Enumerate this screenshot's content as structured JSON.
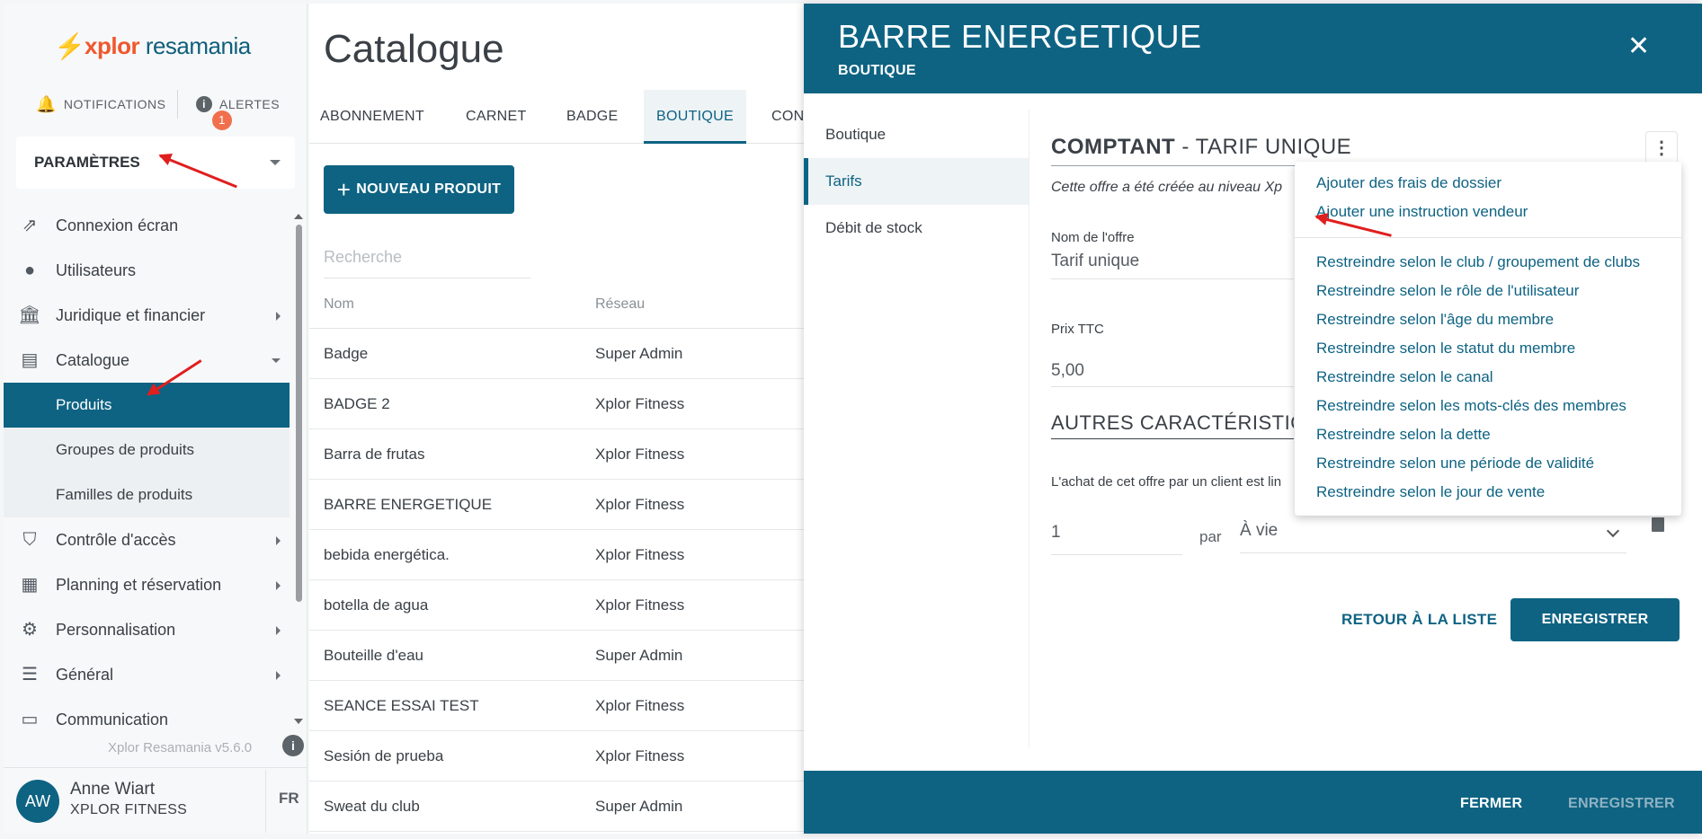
{
  "sidebar": {
    "logo": {
      "brand": "xplor",
      "product": "resamania"
    },
    "notifications_label": "NOTIFICATIONS",
    "alerts_label": "ALERTES",
    "alerts_count": "1",
    "settings_label": "PARAMÈTRES",
    "items": [
      {
        "label": "Connexion écran",
        "icon": "screen-share-icon"
      },
      {
        "label": "Utilisateurs",
        "icon": "user-circle-icon"
      },
      {
        "label": "Juridique et financier",
        "icon": "bank-icon"
      },
      {
        "label": "Catalogue",
        "icon": "library-icon"
      }
    ],
    "catalogue_sub": [
      {
        "label": "Produits"
      },
      {
        "label": "Groupes de produits"
      },
      {
        "label": "Familles de produits"
      }
    ],
    "items2": [
      {
        "label": "Contrôle d'accès",
        "icon": "shield-check-icon"
      },
      {
        "label": "Planning et réservation",
        "icon": "calendar-icon"
      },
      {
        "label": "Personnalisation",
        "icon": "gear-icon"
      },
      {
        "label": "Général",
        "icon": "list-icon"
      },
      {
        "label": "Communication",
        "icon": "contact-card-icon"
      }
    ],
    "version": "Xplor Resamania v5.6.0",
    "user": {
      "initials": "AW",
      "name": "Anne Wiart",
      "org": "XPLOR FITNESS",
      "lang": "FR"
    }
  },
  "catalogue": {
    "title": "Catalogue",
    "tabs": [
      "ABONNEMENT",
      "CARNET",
      "BADGE",
      "BOUTIQUE",
      "CON"
    ],
    "new_button": "NOUVEAU PRODUIT",
    "search_placeholder": "Recherche",
    "columns": [
      "Nom",
      "Réseau"
    ],
    "rows": [
      [
        "Badge",
        "Super Admin"
      ],
      [
        "BADGE 2",
        "Xplor Fitness"
      ],
      [
        "Barra de frutas",
        "Xplor Fitness"
      ],
      [
        "BARRE ENERGETIQUE",
        "Xplor Fitness"
      ],
      [
        "bebida energética.",
        "Xplor Fitness"
      ],
      [
        "botella de agua",
        "Xplor Fitness"
      ],
      [
        "Bouteille d'eau",
        "Super Admin"
      ],
      [
        "SEANCE ESSAI TEST",
        "Xplor Fitness"
      ],
      [
        "Sesión de prueba",
        "Xplor Fitness"
      ],
      [
        "Sweat du club",
        "Super Admin"
      ]
    ]
  },
  "panel": {
    "title": "BARRE ENERGETIQUE",
    "subtitle": "BOUTIQUE",
    "nav": [
      "Boutique",
      "Tarifs",
      "Débit de stock"
    ],
    "section_bold": "COMPTANT",
    "section_rest": " - TARIF UNIQUE",
    "note": "Cette offre a été créée au niveau Xp",
    "offer_name_label": "Nom de l'offre",
    "offer_name_value": "Tarif unique",
    "price_label": "Prix TTC",
    "price_value": "5,00",
    "other_title": "AUTRES CARACTÉRISTIQU",
    "purchase_text": "L'achat de cet offre par un client est lin",
    "qty_value": "1",
    "per_label": "par",
    "period_value": "À vie",
    "back_label": "RETOUR À LA LISTE",
    "save_label": "ENREGISTRER",
    "footer_close": "FERMER",
    "footer_save": "ENREGISTRER"
  },
  "menu": {
    "items": [
      "Ajouter des frais de dossier",
      "Ajouter une instruction vendeur",
      "Restreindre selon le club / groupement de clubs",
      "Restreindre selon le rôle de l'utilisateur",
      "Restreindre selon l'âge du membre",
      "Restreindre selon le statut du membre",
      "Restreindre selon le canal",
      "Restreindre selon les mots-clés des membres",
      "Restreindre selon la dette",
      "Restreindre selon une période de validité",
      "Restreindre selon le jour de vente"
    ]
  },
  "colors": {
    "primary": "#0e6383",
    "accent": "#f0572d",
    "arrow": "#e01f1f"
  }
}
